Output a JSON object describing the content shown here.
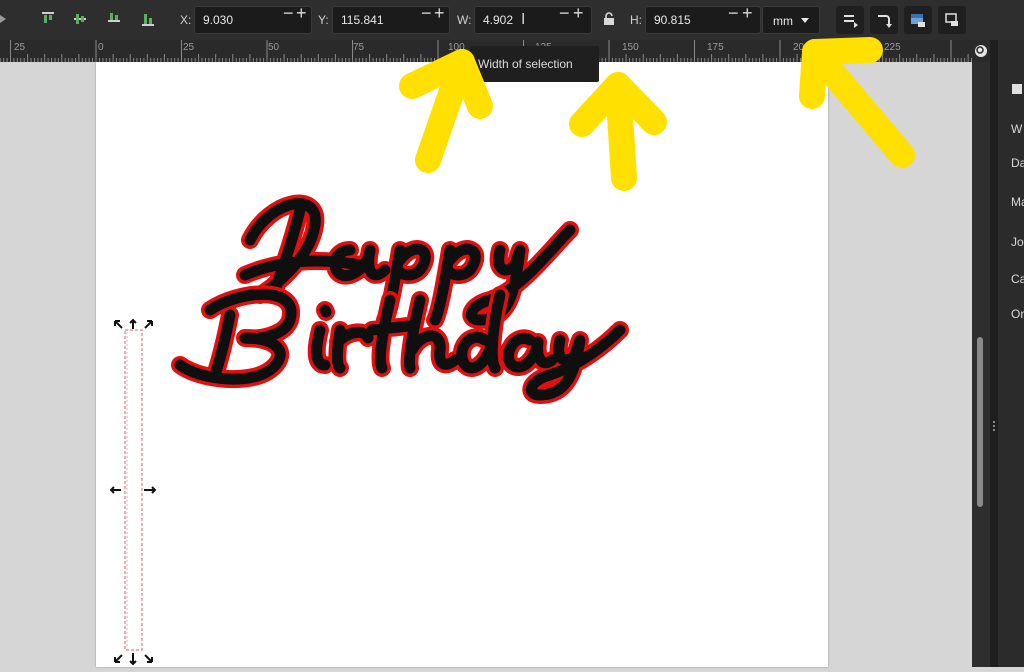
{
  "toolbar": {
    "x_label": "X:",
    "x_value": "9.030",
    "y_label": "Y:",
    "y_value": "115.841",
    "w_label": "W:",
    "w_value": "4.902",
    "h_label": "H:",
    "h_value": "90.815",
    "unit": "mm",
    "stepper_minus": "−",
    "stepper_plus": "+"
  },
  "ruler": {
    "labels": [
      "25",
      "0",
      "25",
      "50",
      "75",
      "100",
      "125",
      "150",
      "175",
      "200",
      "225"
    ]
  },
  "tooltip": {
    "text": "Width of selection"
  },
  "panel": {
    "items": [
      "W",
      "Da",
      "Ma",
      "Jo",
      "Ca",
      "Or"
    ]
  },
  "annotation": {
    "color": "#ffe000"
  }
}
